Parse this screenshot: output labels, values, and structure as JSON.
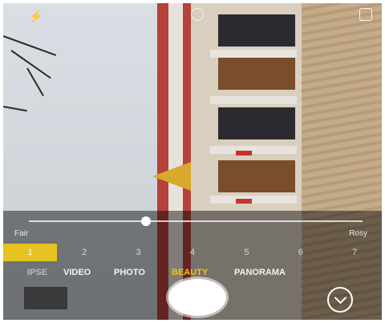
{
  "camera": {
    "top_icons": [
      "flash-icon",
      "timer-icon",
      "switch-camera-icon"
    ],
    "beauty": {
      "slider": {
        "min_label": "Fair",
        "max_label": "Rosy",
        "level_fraction": 0.35
      },
      "levels": [
        "1",
        "2",
        "3",
        "4",
        "5",
        "6",
        "7"
      ],
      "selected_level": "1",
      "highlight_color": "#e6c321"
    },
    "modes": [
      {
        "label": "IPSE",
        "state": "dim"
      },
      {
        "label": "VIDEO",
        "state": "normal"
      },
      {
        "label": "PHOTO",
        "state": "normal"
      },
      {
        "label": "BEAUTY",
        "state": "active"
      },
      {
        "label": "PANORAMA",
        "state": "normal"
      }
    ],
    "active_mode_color": "#f2c21b",
    "bottom": {
      "gallery_icon": "gallery-thumbnail",
      "shutter_icon": "shutter-button",
      "menu_icon": "chevron-down-icon"
    }
  }
}
